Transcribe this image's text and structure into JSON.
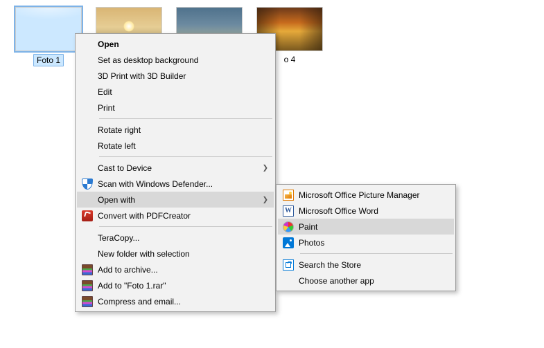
{
  "thumbnails": [
    {
      "label": "Foto 1",
      "selected": true
    },
    {
      "label": ""
    },
    {
      "label": ""
    },
    {
      "label": "o 4"
    }
  ],
  "primary_menu": {
    "open": "Open",
    "set_bg": "Set as desktop background",
    "print3d": "3D Print with 3D Builder",
    "edit": "Edit",
    "print": "Print",
    "rot_r": "Rotate right",
    "rot_l": "Rotate left",
    "cast": "Cast to Device",
    "defender": "Scan with Windows Defender...",
    "open_with": "Open with",
    "pdfcreator": "Convert with PDFCreator",
    "teracopy": "TeraCopy...",
    "newfolder": "New folder with selection",
    "archive": "Add to archive...",
    "addrar": "Add to \"Foto 1.rar\"",
    "compress": "Compress and email..."
  },
  "secondary_menu": {
    "picmgr": "Microsoft Office Picture Manager",
    "word": "Microsoft Office Word",
    "paint": "Paint",
    "photos": "Photos",
    "store": "Search the Store",
    "choose": "Choose another app"
  }
}
